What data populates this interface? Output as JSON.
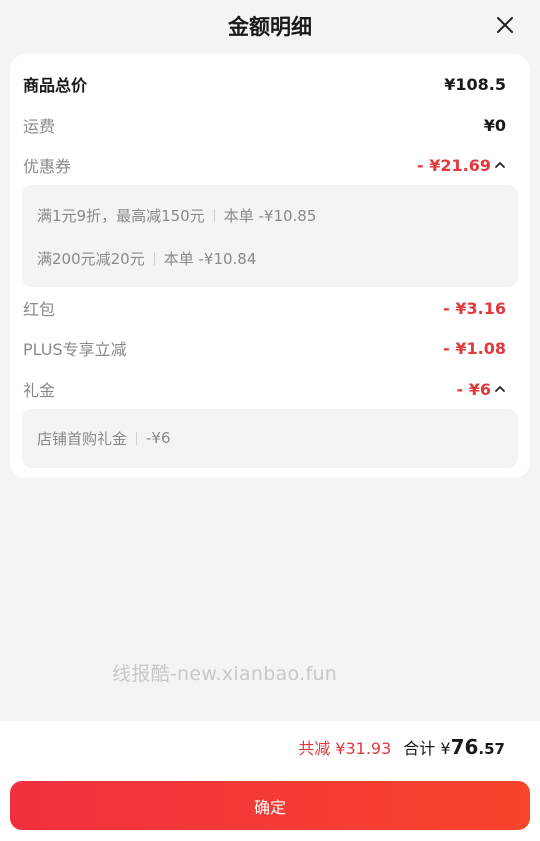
{
  "header": {
    "title": "金额明细"
  },
  "rows": {
    "goods": {
      "label": "商品总价",
      "value": "¥108.5"
    },
    "shipping": {
      "label": "运费",
      "value": "¥0"
    },
    "coupon": {
      "label": "优惠券",
      "value": "- ¥21.69"
    },
    "redpacket": {
      "label": "红包",
      "value": "- ¥3.16"
    },
    "plus": {
      "label": "PLUS专享立减",
      "value": "- ¥1.08"
    },
    "gift": {
      "label": "礼金",
      "value": "- ¥6"
    }
  },
  "coupon_details": [
    {
      "rule": "满1元9折，最高减150元",
      "amount": "本单 -¥10.85"
    },
    {
      "rule": "满200元减20元",
      "amount": "本单 -¥10.84"
    }
  ],
  "gift_details": [
    {
      "rule": "店铺首购礼金",
      "amount": "-¥6"
    }
  ],
  "watermark": "线报酷-new.xianbao.fun",
  "footer": {
    "discount_text": "共减 ¥31.93",
    "total_label": "合计 ¥",
    "total_int": "76",
    "total_dec": ".57",
    "confirm_label": "确定"
  },
  "colors": {
    "accent": "#e4393c",
    "button_start": "#f1303f",
    "button_end": "#f8452b"
  },
  "icons": {
    "close": "close-icon",
    "expand": "chevron-up-icon"
  }
}
